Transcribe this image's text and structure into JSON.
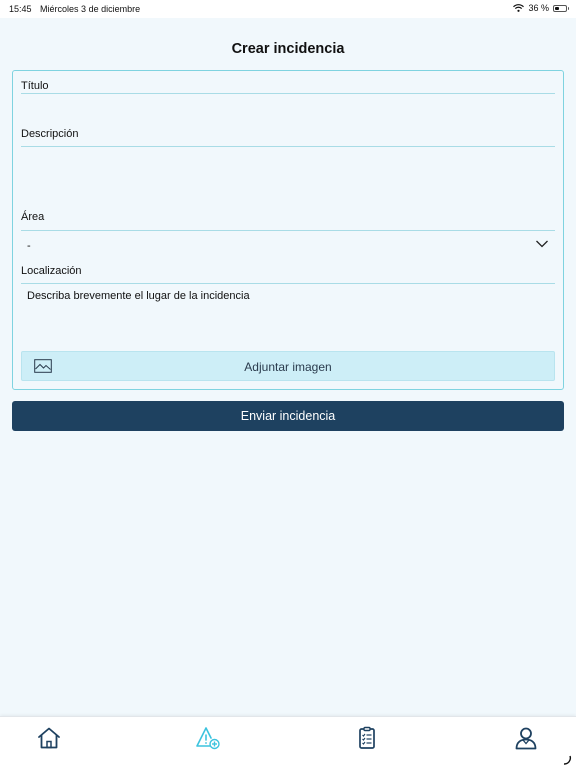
{
  "status_bar": {
    "time": "15:45",
    "date": "Miércoles 3 de diciembre",
    "battery": "36 %",
    "battery_level": 0.36
  },
  "page": {
    "title": "Crear incidencia"
  },
  "form": {
    "title_label": "Título",
    "description_label": "Descripción",
    "area_label": "Área",
    "area_value": "-",
    "location_label": "Localización",
    "location_placeholder": "Describa brevemente el lugar de la incidencia",
    "attach_label": "Adjuntar imagen"
  },
  "submit": {
    "label": "Enviar incidencia"
  },
  "tab_bar": {
    "items": [
      {
        "icon": "home-icon"
      },
      {
        "icon": "create-incident-icon"
      },
      {
        "icon": "clipboard-list-icon"
      },
      {
        "icon": "user-profile-icon"
      }
    ],
    "active_index": 1
  },
  "colors": {
    "background": "#f1f8fc",
    "accent": "#1e4160",
    "border": "#7fd3e0",
    "attach_bg": "#cdeef7",
    "active_tab": "#3cc3de",
    "icon": "#1e4160"
  }
}
